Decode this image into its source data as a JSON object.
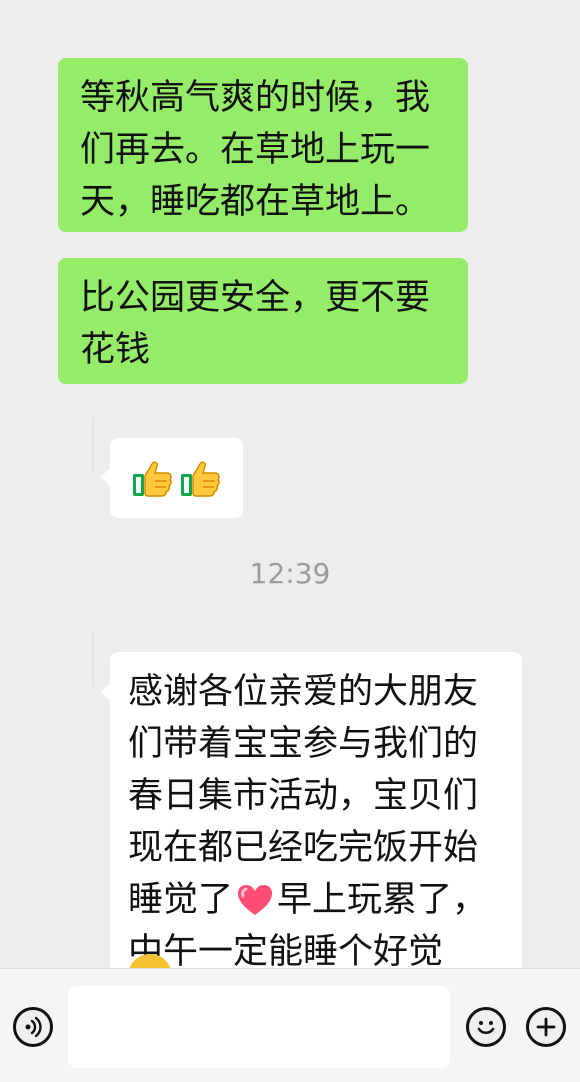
{
  "messages": [
    {
      "id": "msg1",
      "text": "等秋高气爽的时候，我们再去。在草地上玩一天，睡吃都在草地上。"
    },
    {
      "id": "msg2",
      "text": "比公园更安全，更不要花钱"
    },
    {
      "id": "msg3",
      "icons": [
        "thumbs-up-icon",
        "thumbs-up-icon"
      ]
    },
    {
      "id": "msg4",
      "text_before_heart": "感谢各位亲爱的大朋友们带着宝宝参与我们的春日集市活动，宝贝们现在都已经吃完饭开始睡觉了",
      "text_after_heart": "早上玩累了，中午一定能睡个好觉"
    }
  ],
  "timestamp": "12:39",
  "input": {
    "value": "",
    "placeholder": ""
  },
  "icons": {
    "voice": "voice-icon",
    "emoji": "emoji-icon",
    "plus": "plus-icon",
    "heart": "heart-icon"
  },
  "colors": {
    "background": "#ededed",
    "outgoing_bubble": "#95ec69",
    "incoming_bubble": "#ffffff",
    "timestamp": "#9b9b9b"
  }
}
